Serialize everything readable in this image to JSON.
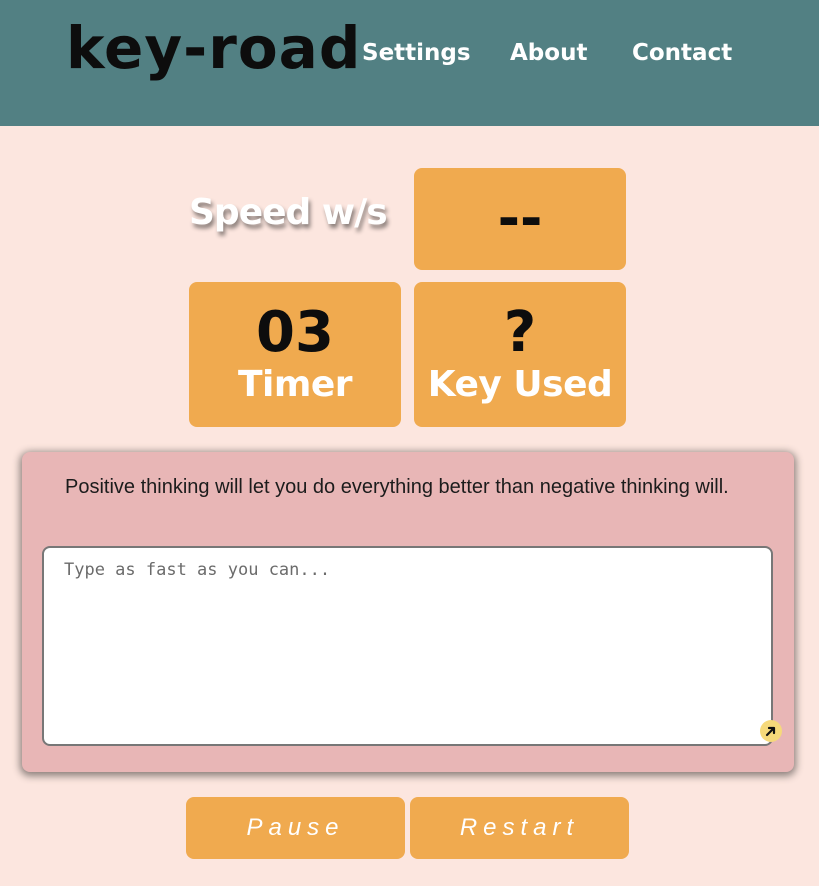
{
  "header": {
    "logo": "key-road",
    "nav": [
      {
        "label": "Settings"
      },
      {
        "label": "About"
      },
      {
        "label": "Contact"
      }
    ],
    "background_color": "#528083"
  },
  "stats": {
    "speed_label": "Speed w/s",
    "speed_value": "--",
    "timer_value": "03",
    "timer_label": "Timer",
    "key_value": "?",
    "key_label": "Key Used",
    "tile_color": "#f0aa4f"
  },
  "panel": {
    "quote": "Positive thinking will let you do everything better than negative thinking will.",
    "input_placeholder": "Type as fast as you can...",
    "input_value": "",
    "background_color": "#e8b6b6"
  },
  "buttons": {
    "pause_label": "Pause",
    "restart_label": "Restart"
  },
  "icons": {
    "resize_icon": "resize-handle-icon"
  },
  "page_background": "#fce6df"
}
